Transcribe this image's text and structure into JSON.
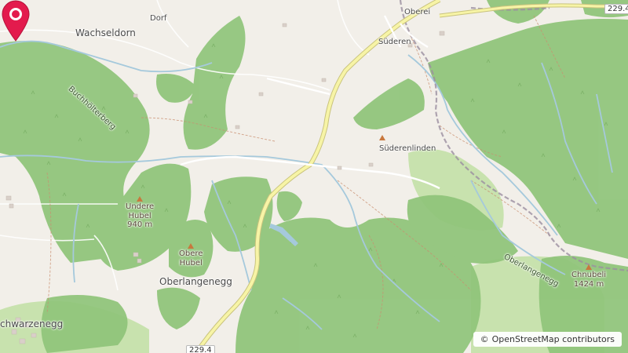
{
  "map": {
    "places": {
      "dorf": "Dorf",
      "wachseldorn": "Wachseldorn",
      "oberei": "Oberei",
      "suederen": "Süderen",
      "suederenlinden": "Süderenlinden",
      "oberlangenegg": "Oberlangenegg",
      "schwarzenegg": "chwarzenegg"
    },
    "peaks": {
      "undere_hubel": {
        "name": "Undere\nHubel",
        "elevation": "940 m"
      },
      "obere_hubel": {
        "name": "Obere\nHubel"
      },
      "chnubeli": {
        "name": "Chnubeli",
        "elevation": "1424 m"
      }
    },
    "ridges": {
      "buchhoelterberg": "Buchhölterberg",
      "oberlangenegg": "Oberlangenegg"
    },
    "road_refs": {
      "top_right": "229.4",
      "bottom": "229.4"
    },
    "marker": {
      "icon": "map-pin-icon",
      "color": "#e31b4d"
    },
    "attribution": {
      "symbol": "©",
      "text": "OpenStreetMap contributors"
    },
    "colors": {
      "background": "#f2efe9",
      "forest": "#8fc479",
      "meadow": "#c8e2ae",
      "road": "#f7f4a6",
      "water": "#a5c9dc",
      "boundary": "#9b8fa0"
    }
  }
}
